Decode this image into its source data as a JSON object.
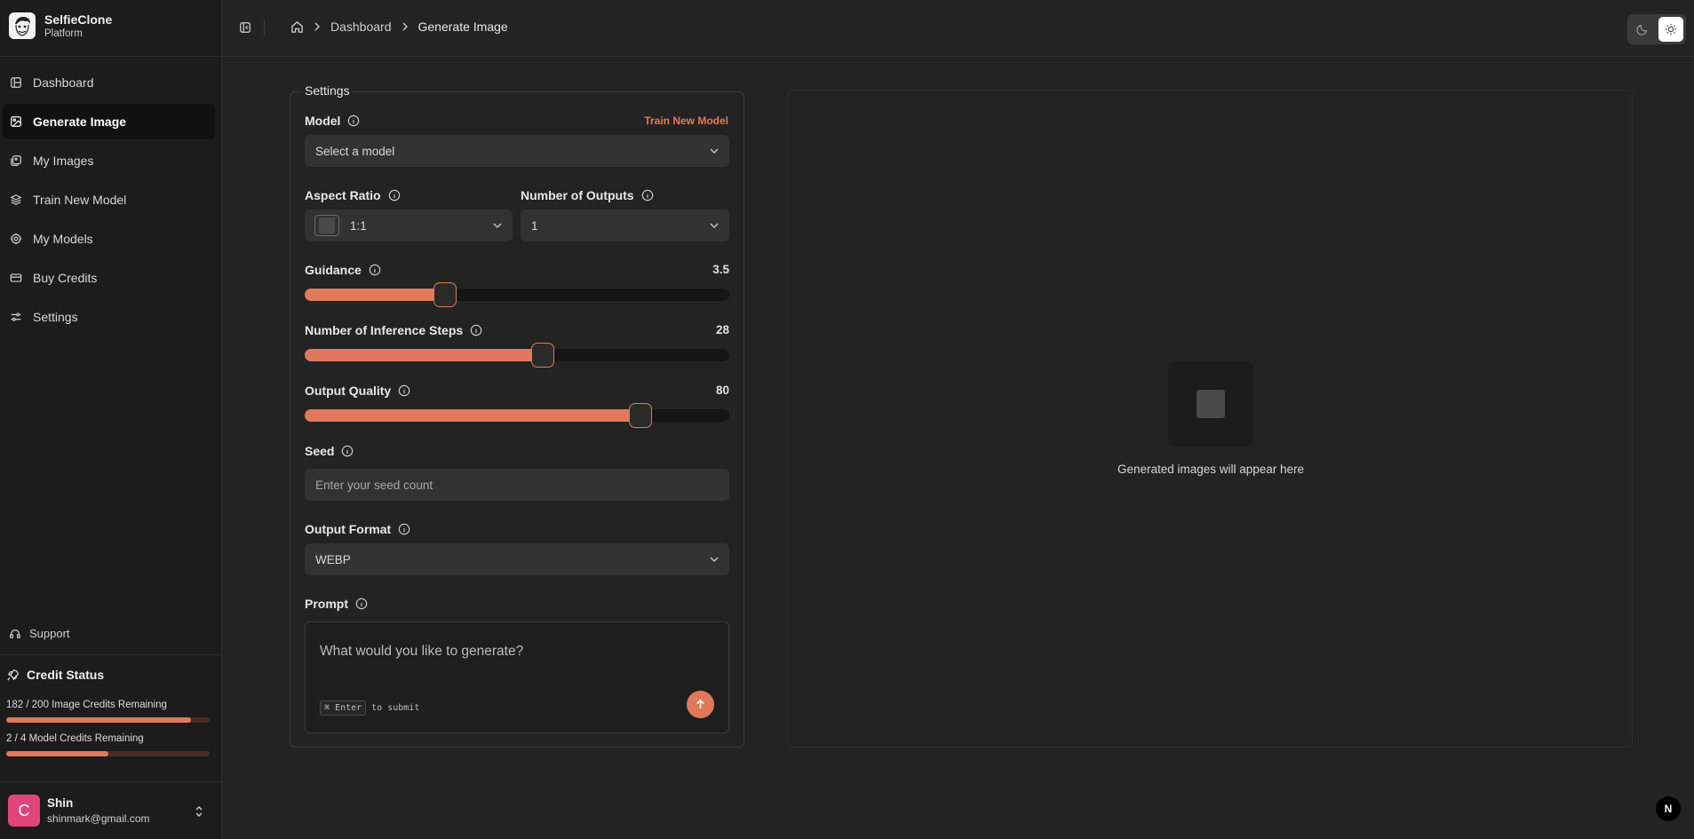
{
  "brand": {
    "name": "SelfieClone",
    "subtitle": "Platform"
  },
  "sidebar": {
    "items": [
      {
        "label": "Dashboard",
        "icon": "dashboard-icon",
        "active": false
      },
      {
        "label": "Generate Image",
        "icon": "image-icon",
        "active": true
      },
      {
        "label": "My Images",
        "icon": "images-icon",
        "active": false
      },
      {
        "label": "Train New Model",
        "icon": "layers-icon",
        "active": false
      },
      {
        "label": "My Models",
        "icon": "cog-icon",
        "active": false
      },
      {
        "label": "Buy Credits",
        "icon": "credit-card-icon",
        "active": false
      },
      {
        "label": "Settings",
        "icon": "sliders-icon",
        "active": false
      }
    ],
    "support_label": "Support"
  },
  "credits": {
    "title": "Credit Status",
    "image_credits_text": "182 / 200 Image Credits Remaining",
    "image_credits_fraction": 0.91,
    "model_credits_text": "2 / 4 Model Credits Remaining",
    "model_credits_fraction": 0.5
  },
  "user": {
    "initial": "C",
    "name": "Shin",
    "email": "shinmark@gmail.com"
  },
  "breadcrumb": {
    "items": [
      "Dashboard",
      "Generate Image"
    ]
  },
  "settings": {
    "legend": "Settings",
    "model": {
      "label": "Model",
      "placeholder": "Select a model",
      "train_link": "Train New Model"
    },
    "aspect_ratio": {
      "label": "Aspect Ratio",
      "value": "1:1"
    },
    "num_outputs": {
      "label": "Number of Outputs",
      "value": "1"
    },
    "guidance": {
      "label": "Guidance",
      "value": "3.5",
      "fraction": 0.33
    },
    "inference_steps": {
      "label": "Number of Inference Steps",
      "value": "28",
      "fraction": 0.56
    },
    "output_quality": {
      "label": "Output Quality",
      "value": "80",
      "fraction": 0.79
    },
    "seed": {
      "label": "Seed",
      "placeholder": "Enter your seed count"
    },
    "output_format": {
      "label": "Output Format",
      "value": "WEBP"
    },
    "prompt": {
      "label": "Prompt",
      "placeholder": "What would you like to generate?",
      "kbd": "⌘ Enter",
      "kbd_suffix": "to submit"
    }
  },
  "preview": {
    "empty_text": "Generated images will appear here"
  },
  "badge": {
    "letter": "N"
  },
  "colors": {
    "accent": "#e0795c",
    "background": "#232323",
    "sidebar": "#1c1c1c",
    "avatar": "#e0457b"
  }
}
